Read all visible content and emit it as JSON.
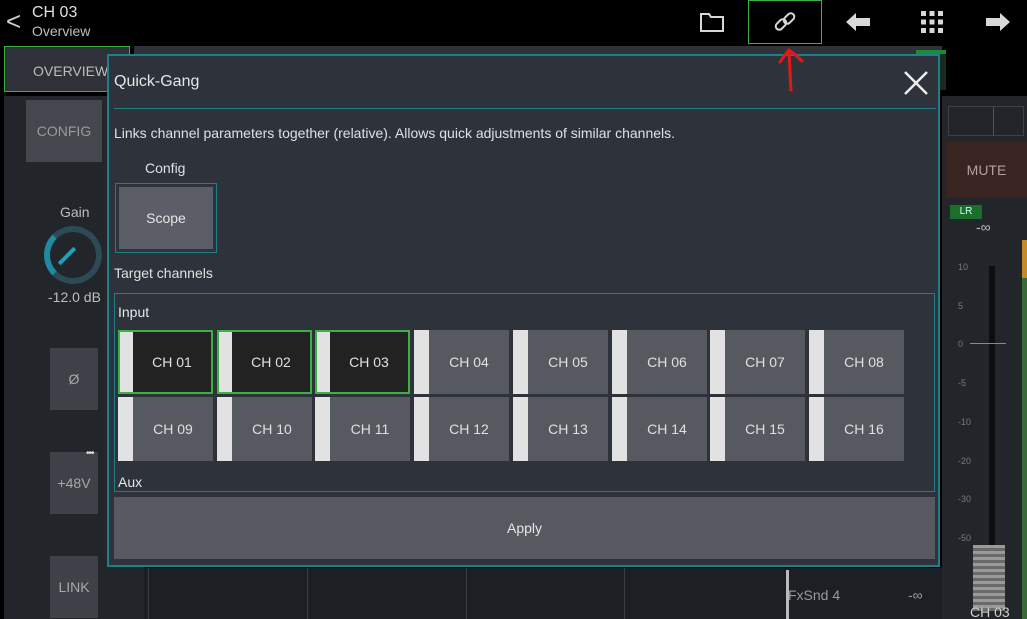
{
  "header": {
    "back_glyph": "<",
    "channel": "CH 03",
    "view": "Overview",
    "icons": [
      "folder-icon",
      "link-icon",
      "arrow-left-icon",
      "grid-icon",
      "arrow-right-icon"
    ]
  },
  "background": {
    "tab_overview": "OVERVIEW",
    "config": "CONFIG",
    "gain_label": "Gain",
    "gain_value": "-12.0 dB",
    "phase": "Ø",
    "phantom": "+48V",
    "link": "LINK",
    "mute": "MUTE",
    "lr": "LR",
    "level": "-∞",
    "scale": [
      "10",
      "5",
      "0",
      "-5",
      "-10",
      "-20",
      "-30",
      "-50"
    ],
    "fader_channel": "CH 03",
    "fx_send": "FxSnd 4",
    "fx_level": "-∞"
  },
  "dialog": {
    "title": "Quick-Gang",
    "description": "Links channel parameters together (relative). Allows quick adjustments of similar channels.",
    "config_label": "Config",
    "scope_button": "Scope",
    "target_label": "Target channels",
    "input_label": "Input",
    "aux_label": "Aux",
    "apply_button": "Apply",
    "channels": [
      {
        "label": "CH 01",
        "selected": true
      },
      {
        "label": "CH 02",
        "selected": true
      },
      {
        "label": "CH 03",
        "selected": true
      },
      {
        "label": "CH 04",
        "selected": false
      },
      {
        "label": "CH 05",
        "selected": false
      },
      {
        "label": "CH 06",
        "selected": false
      },
      {
        "label": "CH 07",
        "selected": false
      },
      {
        "label": "CH 08",
        "selected": false
      },
      {
        "label": "CH 09",
        "selected": false
      },
      {
        "label": "CH 10",
        "selected": false
      },
      {
        "label": "CH 11",
        "selected": false
      },
      {
        "label": "CH 12",
        "selected": false
      },
      {
        "label": "CH 13",
        "selected": false
      },
      {
        "label": "CH 14",
        "selected": false
      },
      {
        "label": "CH 15",
        "selected": false
      },
      {
        "label": "CH 16",
        "selected": false
      }
    ]
  },
  "colors": {
    "accent_teal": "#1e7f87",
    "selected_green": "#3cb043",
    "annotation_red": "#e01818"
  }
}
